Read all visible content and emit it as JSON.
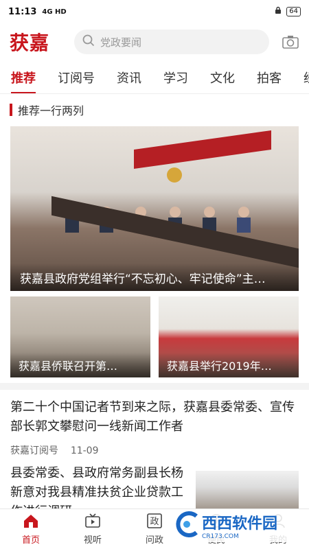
{
  "status": {
    "time": "11:13",
    "signal": "4G HD",
    "battery": "64"
  },
  "header": {
    "logo": "获嘉",
    "search_placeholder": "党政要闻"
  },
  "tabs": [
    {
      "label": "推荐"
    },
    {
      "label": "订阅号"
    },
    {
      "label": "资讯"
    },
    {
      "label": "学习"
    },
    {
      "label": "文化"
    },
    {
      "label": "拍客"
    },
    {
      "label": "经"
    }
  ],
  "section": {
    "title": "推荐一行两列"
  },
  "hero": {
    "caption": "获嘉县政府党组举行“不忘初心、牢记使命”主…"
  },
  "thumbs": [
    {
      "caption": "获嘉县侨联召开第…"
    },
    {
      "caption": "获嘉县举行2019年…"
    }
  ],
  "news": [
    {
      "title": "第二十个中国记者节到来之际，获嘉县委常委、宣传部长郭文攀慰问一线新闻工作者",
      "source": "获嘉订阅号",
      "date": "11-09"
    },
    {
      "title": "县委常委、县政府常务副县长杨新意对我县精准扶贫企业贷款工作进行调研"
    }
  ],
  "bottom_nav": [
    {
      "label": "首页",
      "icon": "home-icon"
    },
    {
      "label": "视听",
      "icon": "tv-icon"
    },
    {
      "label": "问政",
      "icon": "zheng-icon"
    },
    {
      "label": "便民",
      "icon": "service-icon"
    },
    {
      "label": "我的",
      "icon": "user-icon"
    }
  ],
  "watermark": {
    "text": "西西软件园",
    "sub": "CR173.COM"
  },
  "colors": {
    "brand": "#c8161d",
    "search_bg": "#f2f2f2"
  }
}
